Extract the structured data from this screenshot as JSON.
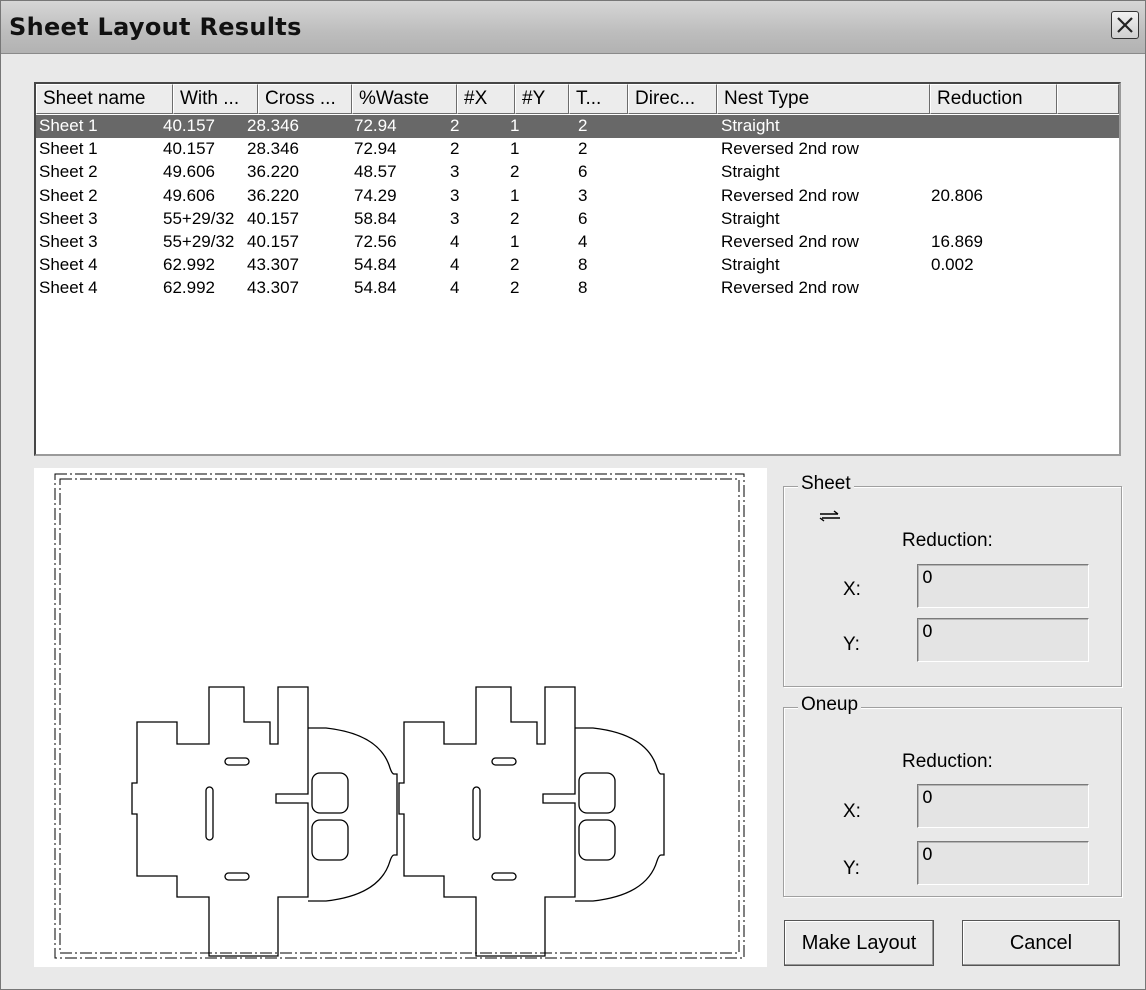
{
  "window": {
    "title": "Sheet Layout Results"
  },
  "table": {
    "columns": [
      "Sheet name",
      "With ...",
      "Cross ...",
      "%Waste",
      "#X",
      "#Y",
      "T...",
      "Direc...",
      "Nest Type",
      "Reduction"
    ],
    "rows": [
      [
        "Sheet 1",
        "40.157",
        "28.346",
        "72.94",
        "2",
        "1",
        "2",
        "",
        "Straight",
        ""
      ],
      [
        "Sheet 1",
        "40.157",
        "28.346",
        "72.94",
        "2",
        "1",
        "2",
        "",
        "Reversed 2nd row",
        ""
      ],
      [
        "Sheet 2",
        "49.606",
        "36.220",
        "48.57",
        "3",
        "2",
        "6",
        "",
        "Straight",
        ""
      ],
      [
        "Sheet 2",
        "49.606",
        "36.220",
        "74.29",
        "3",
        "1",
        "3",
        "",
        "Reversed 2nd row",
        "20.806"
      ],
      [
        "Sheet 3",
        "55+29/32",
        "40.157",
        "58.84",
        "3",
        "2",
        "6",
        "",
        "Straight",
        ""
      ],
      [
        "Sheet 3",
        "55+29/32",
        "40.157",
        "72.56",
        "4",
        "1",
        "4",
        "",
        "Reversed 2nd row",
        "16.869"
      ],
      [
        "Sheet 4",
        "62.992",
        "43.307",
        "54.84",
        "4",
        "2",
        "8",
        "",
        "Straight",
        "0.002"
      ],
      [
        "Sheet 4",
        "62.992",
        "43.307",
        "54.84",
        "4",
        "2",
        "8",
        "",
        "Reversed 2nd row",
        ""
      ]
    ],
    "selected_row": 0
  },
  "sheet_group": {
    "label": "Sheet",
    "direction_icon": "horizontal-arrow-icon",
    "reduction_label": "Reduction:",
    "x_label": "X:",
    "y_label": "Y:",
    "x_value": "0",
    "y_value": "0"
  },
  "oneup_group": {
    "label": "Oneup",
    "reduction_label": "Reduction:",
    "x_label": "X:",
    "y_label": "Y:",
    "x_value": "0",
    "y_value": "0"
  },
  "buttons": {
    "make_layout": "Make Layout",
    "cancel": "Cancel"
  },
  "colors": {
    "selection": "#686868",
    "background": "#e9e9e9"
  }
}
